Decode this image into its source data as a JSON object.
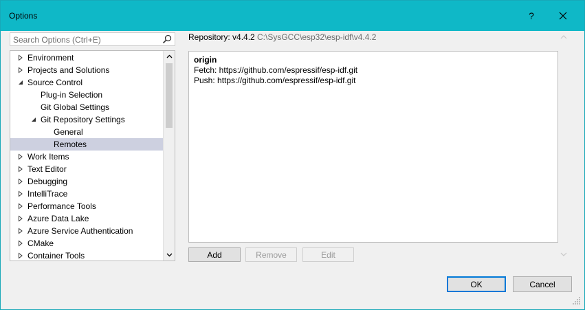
{
  "window": {
    "title": "Options"
  },
  "search": {
    "placeholder": "Search Options (Ctrl+E)"
  },
  "tree": {
    "items": [
      {
        "label": "Environment",
        "level": 0,
        "expanded": false
      },
      {
        "label": "Projects and Solutions",
        "level": 0,
        "expanded": false
      },
      {
        "label": "Source Control",
        "level": 0,
        "expanded": true
      },
      {
        "label": "Plug-in Selection",
        "level": 1,
        "expanded": null
      },
      {
        "label": "Git Global Settings",
        "level": 1,
        "expanded": null
      },
      {
        "label": "Git Repository Settings",
        "level": 1,
        "expanded": true
      },
      {
        "label": "General",
        "level": 2,
        "expanded": null
      },
      {
        "label": "Remotes",
        "level": 2,
        "expanded": null,
        "selected": true
      },
      {
        "label": "Work Items",
        "level": 0,
        "expanded": false
      },
      {
        "label": "Text Editor",
        "level": 0,
        "expanded": false
      },
      {
        "label": "Debugging",
        "level": 0,
        "expanded": false
      },
      {
        "label": "IntelliTrace",
        "level": 0,
        "expanded": false
      },
      {
        "label": "Performance Tools",
        "level": 0,
        "expanded": false
      },
      {
        "label": "Azure Data Lake",
        "level": 0,
        "expanded": false
      },
      {
        "label": "Azure Service Authentication",
        "level": 0,
        "expanded": false
      },
      {
        "label": "CMake",
        "level": 0,
        "expanded": false
      },
      {
        "label": "Container Tools",
        "level": 0,
        "expanded": false
      }
    ]
  },
  "repository": {
    "label": "Repository: v4.4.2",
    "path": "C:\\SysGCC\\esp32\\esp-idf\\v4.4.2"
  },
  "remote": {
    "name": "origin",
    "fetch": "Fetch: https://github.com/espressif/esp-idf.git",
    "push": "Push: https://github.com/espressif/esp-idf.git"
  },
  "buttons": {
    "add": "Add",
    "remove": "Remove",
    "edit": "Edit",
    "ok": "OK",
    "cancel": "Cancel"
  },
  "icons": {
    "help": "question-mark",
    "close": "close-x",
    "search": "magnifier"
  },
  "colors": {
    "title_bar": "#0fb8c7",
    "selected_row": "#cdd0e0",
    "focus_border": "#0078d7"
  }
}
